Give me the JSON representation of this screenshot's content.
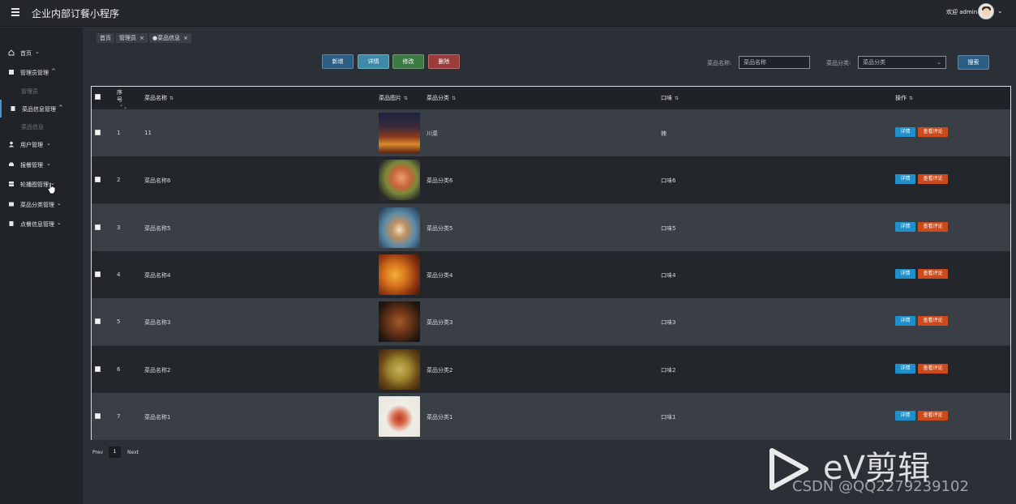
{
  "header": {
    "title": "企业内部订餐小程序",
    "welcome": "欢迎 admin"
  },
  "sidebar": {
    "items": [
      {
        "label": "首页",
        "chev": "⌄"
      },
      {
        "label": "管理员管理",
        "chev": "^",
        "sub": "管理员"
      },
      {
        "label": "菜品信息管理",
        "chev": "^",
        "sub": "菜品信息"
      },
      {
        "label": "用户管理",
        "chev": "⌄"
      },
      {
        "label": "报餐管理",
        "chev": "⌄"
      },
      {
        "label": "轮播图管理",
        "chev": "⌄"
      },
      {
        "label": "菜品分类管理",
        "chev": "⌄"
      },
      {
        "label": "点餐信息管理",
        "chev": "⌄"
      }
    ]
  },
  "tabs": [
    {
      "label": "首页"
    },
    {
      "label": "管理员",
      "close": "×"
    },
    {
      "label": "●菜品信息",
      "close": "×"
    }
  ],
  "toolbar": {
    "add": "新增",
    "detail": "详情",
    "edit": "修改",
    "delete": "删除",
    "name_label": "菜品名称:",
    "name_placeholder": "菜品名称",
    "category_label": "菜品分类:",
    "category_value": "菜品分类",
    "search": "搜索"
  },
  "table": {
    "headers": {
      "index": "序号",
      "name": "菜品名称",
      "image": "菜品图片",
      "category": "菜品分类",
      "taste": "口味",
      "actions": "操作"
    },
    "rows": [
      {
        "index": "1",
        "name": "11",
        "category": "川菜",
        "taste": "辣"
      },
      {
        "index": "2",
        "name": "菜品名称6",
        "category": "菜品分类6",
        "taste": "口味6"
      },
      {
        "index": "3",
        "name": "菜品名称5",
        "category": "菜品分类5",
        "taste": "口味5"
      },
      {
        "index": "4",
        "name": "菜品名称4",
        "category": "菜品分类4",
        "taste": "口味4"
      },
      {
        "index": "5",
        "name": "菜品名称3",
        "category": "菜品分类3",
        "taste": "口味3"
      },
      {
        "index": "6",
        "name": "菜品名称2",
        "category": "菜品分类2",
        "taste": "口味2"
      },
      {
        "index": "7",
        "name": "菜品名称1",
        "category": "菜品分类1",
        "taste": "口味1"
      }
    ],
    "row_actions": {
      "detail": "详情",
      "review": "查看评论"
    }
  },
  "pagination": {
    "prev": "Prev",
    "page": "1",
    "next": "Next"
  },
  "watermark": {
    "brand": "eV剪辑",
    "csdn": "CSDN @QQ2279239102"
  },
  "colors": {
    "accent": "#2c5d83",
    "danger": "#9b3b3b",
    "success": "#3e7a44",
    "review": "#c94b1e",
    "info": "#1e8fc9"
  }
}
